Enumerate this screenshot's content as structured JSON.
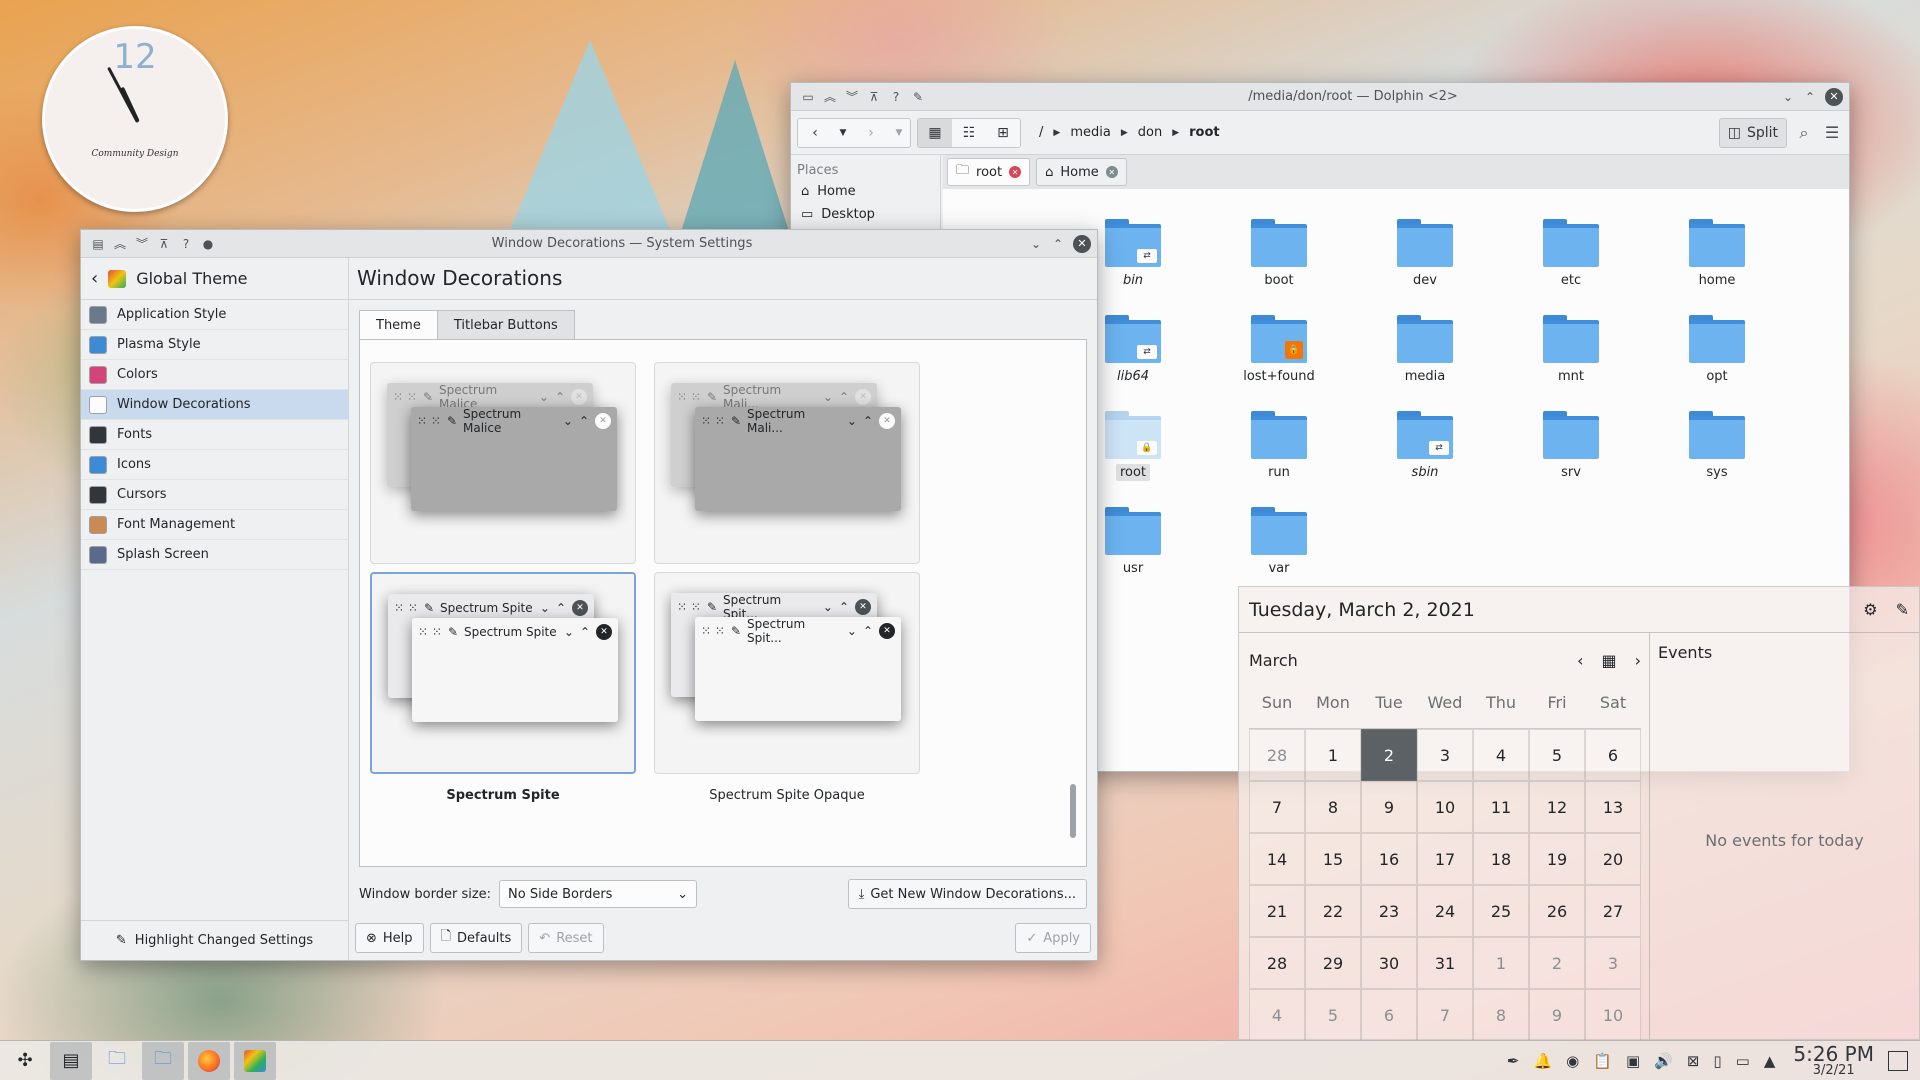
{
  "clock_widget": {
    "numeral": "12",
    "brand": "Community Design"
  },
  "dolphin": {
    "title": "/media/don/root — Dolphin <2>",
    "breadcrumb": [
      "/",
      "media",
      "don",
      "root"
    ],
    "split_label": "Split",
    "places_header": "Places",
    "places": [
      "Home",
      "Desktop"
    ],
    "tabs": [
      {
        "label": "root"
      },
      {
        "label": "Home"
      }
    ],
    "items": [
      {
        "name": "bin",
        "italic": true,
        "badge": "link"
      },
      {
        "name": "boot",
        "italic": false,
        "badge": ""
      },
      {
        "name": "dev",
        "italic": false,
        "badge": ""
      },
      {
        "name": "etc",
        "italic": false,
        "badge": ""
      },
      {
        "name": "home",
        "italic": false,
        "badge": ""
      },
      {
        "name": "lib64",
        "italic": true,
        "badge": "link"
      },
      {
        "name": "lost+found",
        "italic": false,
        "badge": "lock"
      },
      {
        "name": "media",
        "italic": false,
        "badge": ""
      },
      {
        "name": "mnt",
        "italic": false,
        "badge": ""
      },
      {
        "name": "opt",
        "italic": false,
        "badge": ""
      },
      {
        "name": "root",
        "italic": false,
        "badge": "lock-grey"
      },
      {
        "name": "run",
        "italic": false,
        "badge": ""
      },
      {
        "name": "sbin",
        "italic": true,
        "badge": "link"
      },
      {
        "name": "srv",
        "italic": false,
        "badge": ""
      },
      {
        "name": "sys",
        "italic": false,
        "badge": ""
      },
      {
        "name": "usr",
        "italic": false,
        "badge": ""
      },
      {
        "name": "var",
        "italic": false,
        "badge": ""
      }
    ]
  },
  "settings": {
    "title": "Window Decorations — System Settings",
    "back_section": "Global Theme",
    "sidebar": [
      {
        "label": "Application Style",
        "color": "#6b7a8a"
      },
      {
        "label": "Plasma Style",
        "color": "#3d8bd6"
      },
      {
        "label": "Colors",
        "color": "#d4447a"
      },
      {
        "label": "Window Decorations",
        "color": "#fcfcfc"
      },
      {
        "label": "Fonts",
        "color": "#31363b"
      },
      {
        "label": "Icons",
        "color": "#3d8bd6"
      },
      {
        "label": "Cursors",
        "color": "#31363b"
      },
      {
        "label": "Font Management",
        "color": "#c98a55"
      },
      {
        "label": "Splash Screen",
        "color": "#5a6a8a"
      }
    ],
    "highlight_label": "Highlight Changed Settings",
    "page_title": "Window Decorations",
    "tabs": [
      "Theme",
      "Titlebar Buttons"
    ],
    "decorations": [
      {
        "label": "Spectrum Malice",
        "back_title": "Spectrum Malice",
        "front_title": "Spectrum Malice",
        "style": "malice"
      },
      {
        "label": "Spectrum Malice Opaque",
        "back_title": "Spectrum Mali...",
        "front_title": "Spectrum Mali...",
        "style": "malice"
      },
      {
        "label": "Spectrum Spite",
        "back_title": "Spectrum Spite",
        "front_title": "Spectrum Spite",
        "style": "spite"
      },
      {
        "label": "Spectrum Spite Opaque",
        "back_title": "Spectrum Spit...",
        "front_title": "Spectrum Spit...",
        "style": "spite"
      }
    ],
    "border_size_label": "Window border size:",
    "border_size_value": "No Side Borders",
    "get_new_label": "Get New Window Decorations...",
    "help_label": "Help",
    "defaults_label": "Defaults",
    "reset_label": "Reset",
    "apply_label": "Apply"
  },
  "calendar": {
    "date_title": "Tuesday, March 2, 2021",
    "month": "March",
    "weekdays": [
      "Sun",
      "Mon",
      "Tue",
      "Wed",
      "Thu",
      "Fri",
      "Sat"
    ],
    "days": [
      {
        "d": "28",
        "o": true
      },
      {
        "d": "1"
      },
      {
        "d": "2",
        "today": true
      },
      {
        "d": "3"
      },
      {
        "d": "4"
      },
      {
        "d": "5"
      },
      {
        "d": "6"
      },
      {
        "d": "7"
      },
      {
        "d": "8"
      },
      {
        "d": "9"
      },
      {
        "d": "10"
      },
      {
        "d": "11"
      },
      {
        "d": "12"
      },
      {
        "d": "13"
      },
      {
        "d": "14"
      },
      {
        "d": "15"
      },
      {
        "d": "16"
      },
      {
        "d": "17"
      },
      {
        "d": "18"
      },
      {
        "d": "19"
      },
      {
        "d": "20"
      },
      {
        "d": "21"
      },
      {
        "d": "22"
      },
      {
        "d": "23"
      },
      {
        "d": "24"
      },
      {
        "d": "25"
      },
      {
        "d": "26"
      },
      {
        "d": "27"
      },
      {
        "d": "28"
      },
      {
        "d": "29"
      },
      {
        "d": "30"
      },
      {
        "d": "31"
      },
      {
        "d": "1",
        "o": true
      },
      {
        "d": "2",
        "o": true
      },
      {
        "d": "3",
        "o": true
      },
      {
        "d": "4",
        "o": true
      },
      {
        "d": "5",
        "o": true
      },
      {
        "d": "6",
        "o": true
      },
      {
        "d": "7",
        "o": true
      },
      {
        "d": "8",
        "o": true
      },
      {
        "d": "9",
        "o": true
      },
      {
        "d": "10",
        "o": true
      }
    ],
    "events_header": "Events",
    "no_events": "No events for today"
  },
  "taskbar": {
    "time": "5:26 PM",
    "date": "3/2/21",
    "apps": [
      "launcher-icon",
      "system-settings-icon",
      "file-manager-icon",
      "dolphin-icon",
      "firefox-icon",
      "krita-icon"
    ]
  }
}
